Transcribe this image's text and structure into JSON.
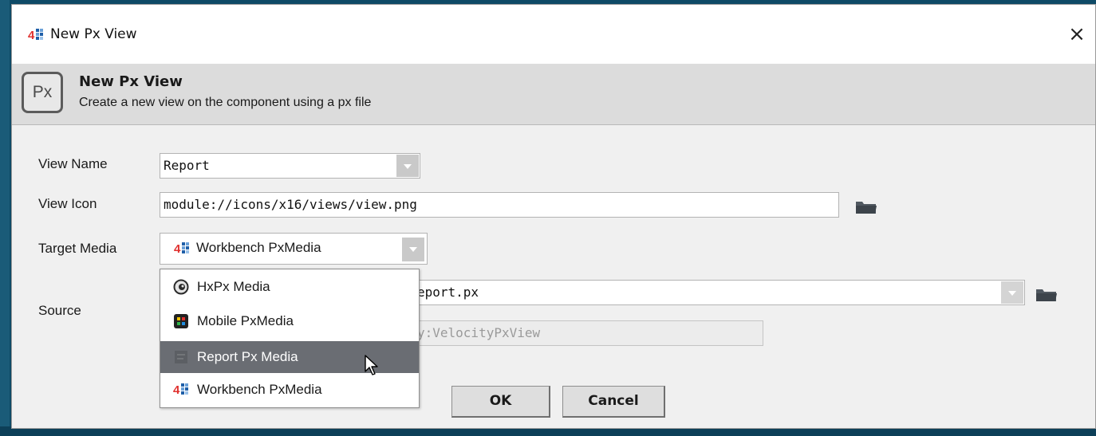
{
  "window": {
    "title": "New Px View",
    "close_glyph": "×",
    "app_icon": "niagara-4-icon"
  },
  "header": {
    "badge": "Px",
    "title": "New Px View",
    "subtitle": "Create a new view on the component using a px file"
  },
  "form": {
    "view_name": {
      "label": "View Name",
      "value": "Report"
    },
    "view_icon": {
      "label": "View Icon",
      "value": "module://icons/x16/views/view.png"
    },
    "target_media": {
      "label": "Target Media",
      "value": "Workbench PxMedia"
    },
    "source": {
      "label": "Source",
      "file_visible": "eport.px",
      "type_visible": "y:VelocityPxView"
    }
  },
  "dropdown": {
    "options": [
      {
        "label": "HxPx Media",
        "icon": "hx-media-icon"
      },
      {
        "label": "Mobile PxMedia",
        "icon": "mobile-media-icon"
      },
      {
        "label": "Report Px Media",
        "icon": "report-media-icon",
        "selected": true
      },
      {
        "label": "Workbench PxMedia",
        "icon": "niagara-4-icon"
      }
    ]
  },
  "buttons": {
    "ok": "OK",
    "cancel": "Cancel"
  },
  "colors": {
    "desktop": "#0e4a66",
    "dialog_bg": "#f0f0f0",
    "header_bg": "#dcdcdc",
    "selected_option": "#6a6d73",
    "niagara_red": "#e0312f",
    "niagara_blue": "#1f5fa8",
    "folder": "#505860"
  }
}
